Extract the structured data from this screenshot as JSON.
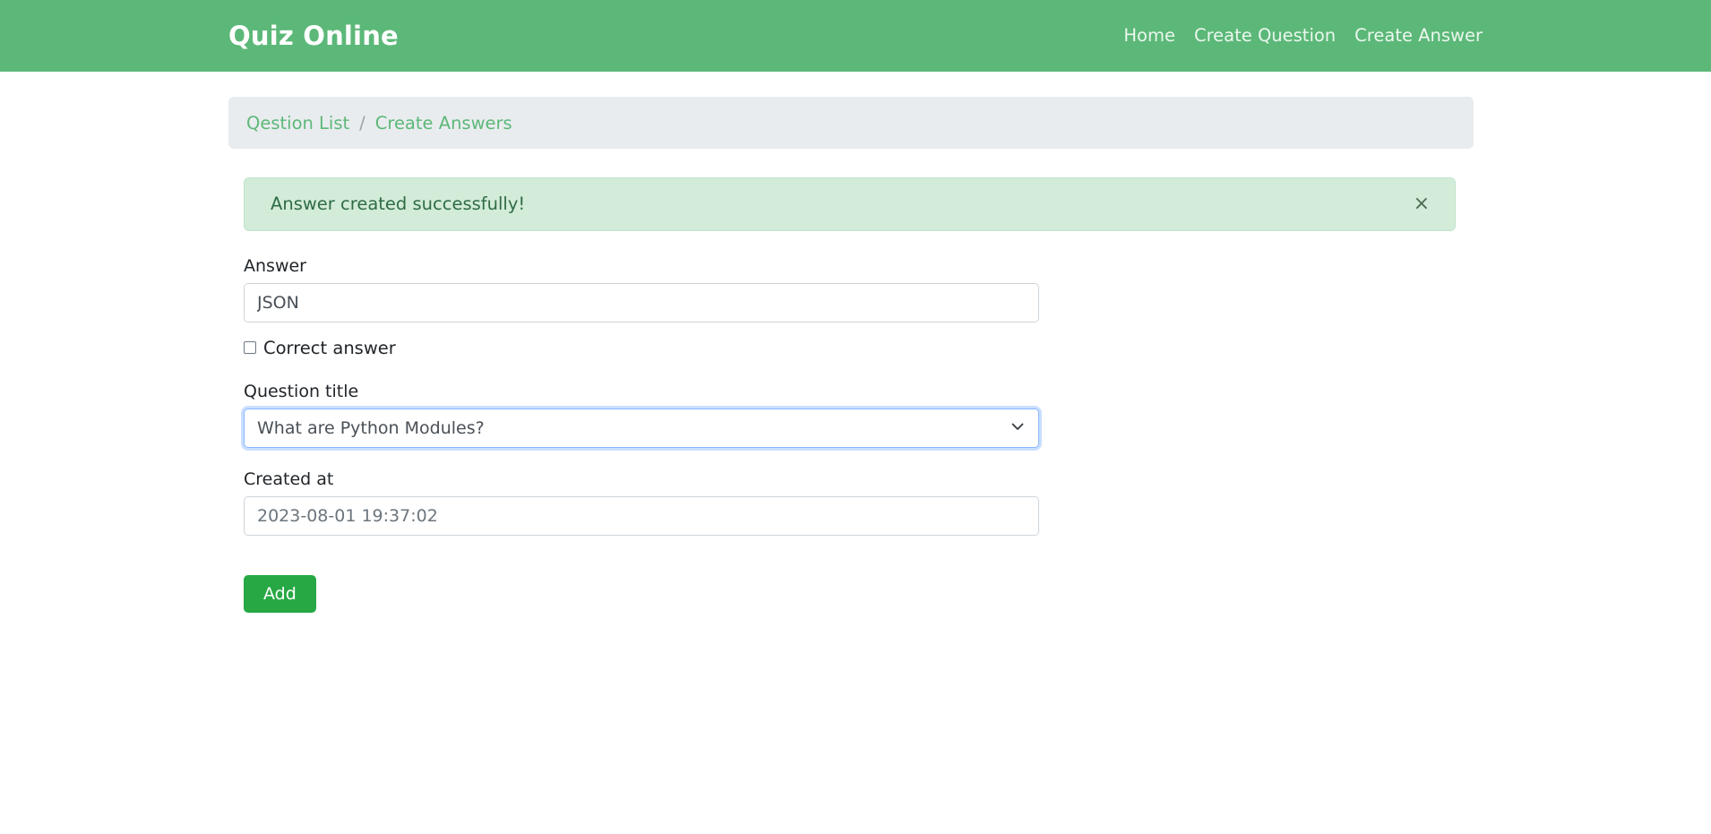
{
  "navbar": {
    "brand": "Quiz Online",
    "links": [
      {
        "label": "Home",
        "name": "nav-link-home"
      },
      {
        "label": "Create Question",
        "name": "nav-link-create-question"
      },
      {
        "label": "Create Answer",
        "name": "nav-link-create-answer"
      }
    ],
    "background_color": "#5cb878"
  },
  "breadcrumb": {
    "items": [
      {
        "label": "Qestion List"
      },
      {
        "label": "Create Answers"
      }
    ],
    "separator": "/",
    "background_color": "#e9ecef",
    "link_color": "#5cb878"
  },
  "alert": {
    "message": "Answer created successfully!",
    "close_icon": "×",
    "background_color": "#d2ecd9",
    "text_color": "#2f6b45"
  },
  "form": {
    "answer": {
      "label": "Answer",
      "value": "JSON",
      "placeholder": "Answer"
    },
    "correct_answer": {
      "label": "Correct answer",
      "checked": false
    },
    "question_title": {
      "label": "Question title",
      "selected": "What are Python Modules?",
      "options": [
        "What are Python Modules?"
      ]
    },
    "created_at": {
      "label": "Created at",
      "value": "2023-08-01 19:37:02",
      "placeholder": "Created at"
    },
    "submit": {
      "label": "Add",
      "color": "#27a844"
    }
  }
}
